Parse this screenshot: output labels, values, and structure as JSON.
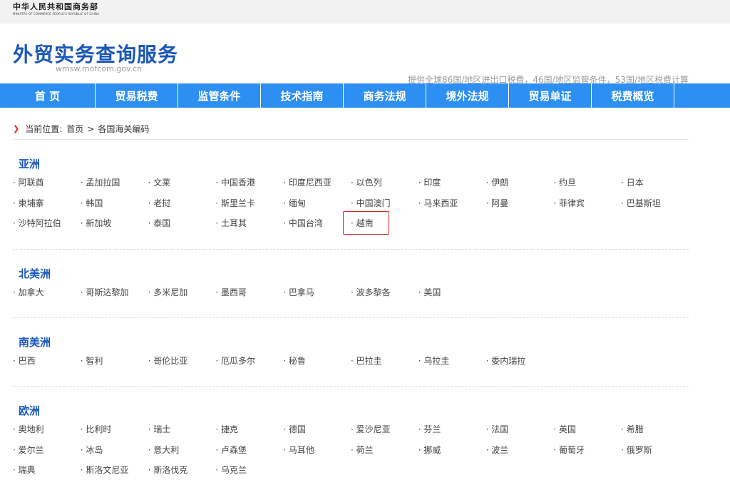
{
  "ministry": {
    "name_cn": "中华人民共和国商务部",
    "name_en": "MINISTRY OF COMMERCE PEOPLE'S REPUBLIC OF CHINA"
  },
  "site": {
    "title": "外贸实务查询服务",
    "domain": "wmsw.mofcom.gov.cn",
    "description": "提供全球86国/地区进出口税费，46国/地区监管条件，53国/地区税费计算"
  },
  "nav": [
    "首 页",
    "贸易税费",
    "监管条件",
    "技术指南",
    "商务法规",
    "境外法规",
    "贸易单证",
    "税费概览"
  ],
  "breadcrumb": {
    "label": "当前位置:",
    "home": "首页",
    "separator": ">",
    "current": "各国海关编码"
  },
  "highlight": "越南",
  "accent_color": "#2d8ff2",
  "title_color": "#1a57b8",
  "highlight_color": "#e02020",
  "regions": [
    {
      "title": "亚洲",
      "countries": [
        "阿联酋",
        "孟加拉国",
        "文莱",
        "中国香港",
        "印度尼西亚",
        "以色列",
        "印度",
        "伊朗",
        "约旦",
        "日本",
        "柬埔寨",
        "韩国",
        "老挝",
        "斯里兰卡",
        "缅甸",
        "中国澳门",
        "马来西亚",
        "阿曼",
        "菲律宾",
        "巴基斯坦",
        "沙特阿拉伯",
        "新加坡",
        "泰国",
        "土耳其",
        "中国台湾",
        "越南"
      ]
    },
    {
      "title": "北美洲",
      "countries": [
        "加拿大",
        "哥斯达黎加",
        "多米尼加",
        "墨西哥",
        "巴拿马",
        "波多黎各",
        "美国"
      ]
    },
    {
      "title": "南美洲",
      "countries": [
        "巴西",
        "智利",
        "哥伦比亚",
        "厄瓜多尔",
        "秘鲁",
        "巴拉圭",
        "乌拉圭",
        "委内瑞拉"
      ]
    },
    {
      "title": "欧洲",
      "countries": [
        "奥地利",
        "比利时",
        "瑞士",
        "捷克",
        "德国",
        "爱沙尼亚",
        "芬兰",
        "法国",
        "英国",
        "希腊",
        "爱尔兰",
        "冰岛",
        "意大利",
        "卢森堡",
        "马耳他",
        "荷兰",
        "挪威",
        "波兰",
        "葡萄牙",
        "俄罗斯",
        "瑞典",
        "斯洛文尼亚",
        "斯洛伐克",
        "乌克兰"
      ]
    }
  ]
}
